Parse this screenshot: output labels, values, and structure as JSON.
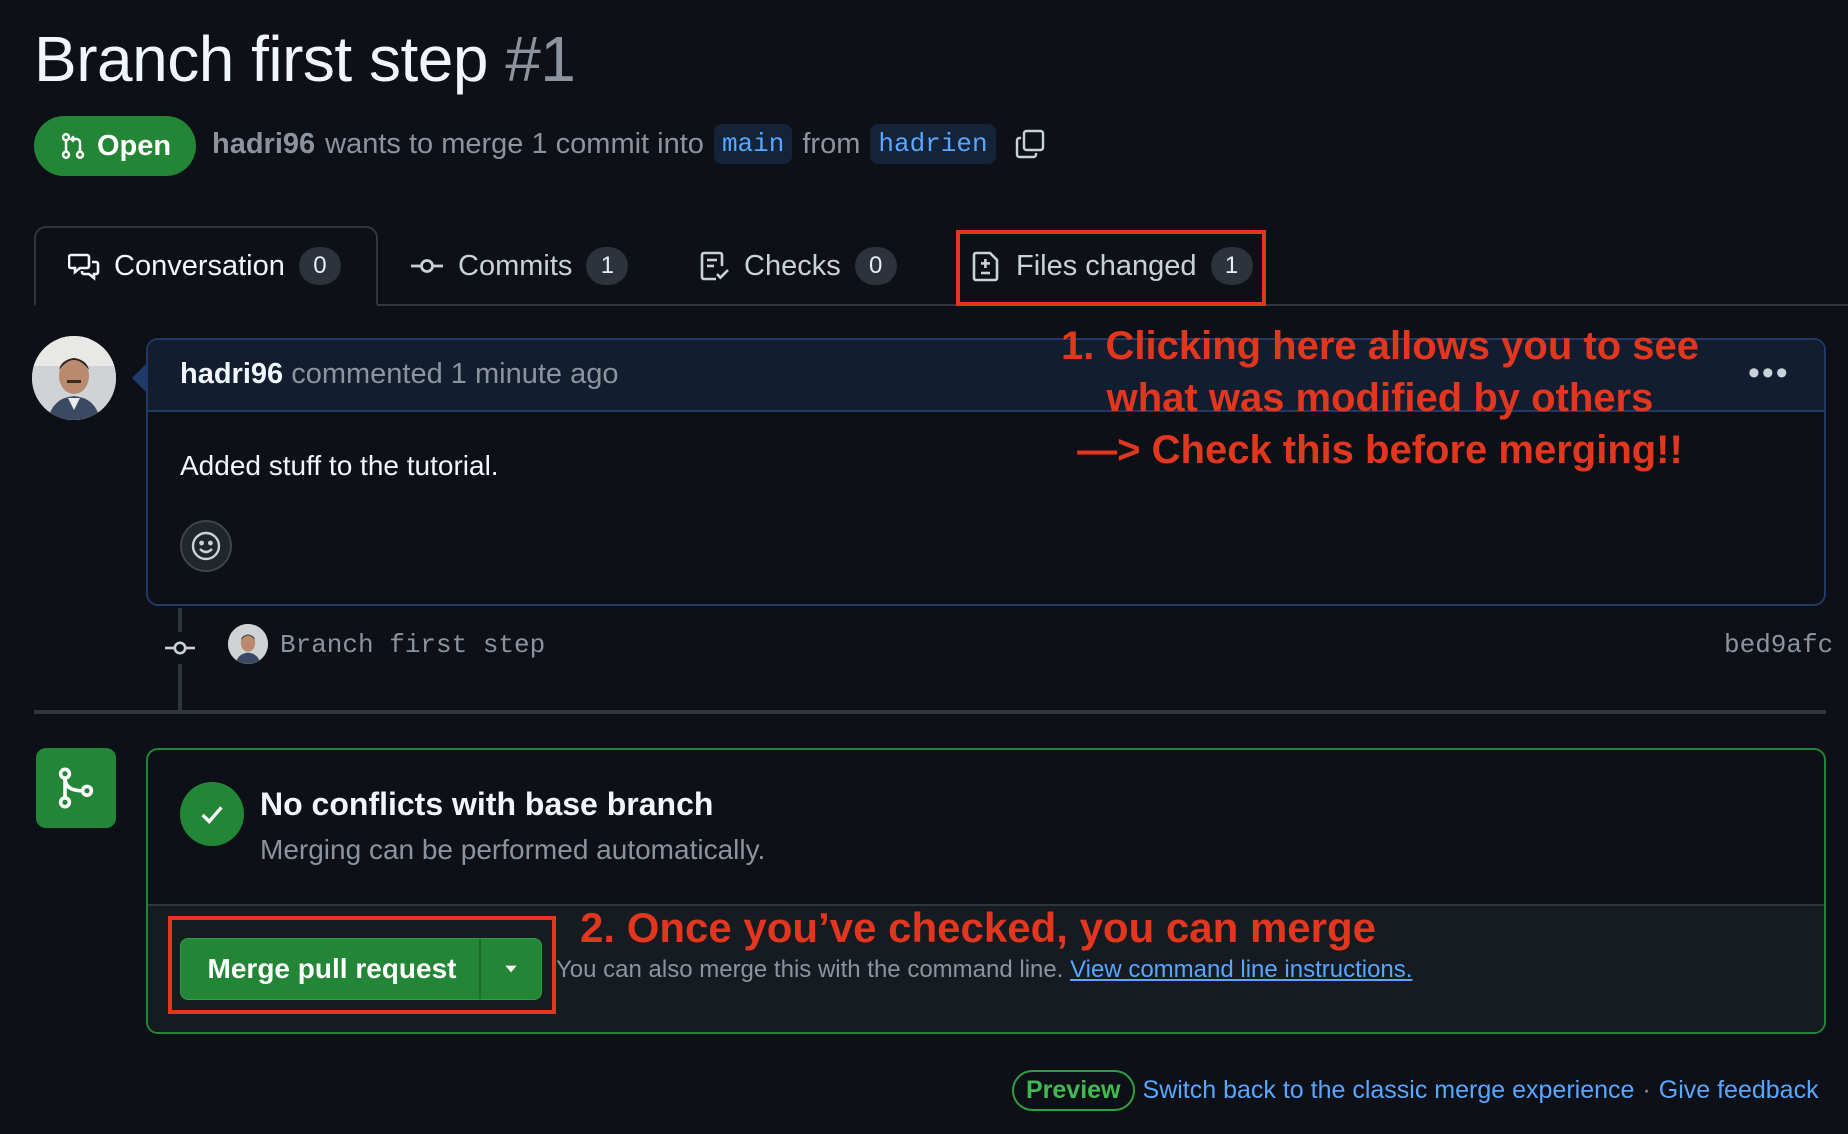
{
  "pr": {
    "title": "Branch first step",
    "number": "#1",
    "status": "Open",
    "author": "hadri96",
    "merge_text": "wants to merge 1 commit into",
    "base_branch": "main",
    "from_text": "from",
    "head_branch": "hadrien"
  },
  "tabs": [
    {
      "label": "Conversation",
      "count": "0",
      "icon": "comment-discussion-icon"
    },
    {
      "label": "Commits",
      "count": "1",
      "icon": "commit-icon"
    },
    {
      "label": "Checks",
      "count": "0",
      "icon": "checklist-icon"
    },
    {
      "label": "Files changed",
      "count": "1",
      "icon": "file-diff-icon"
    }
  ],
  "comment": {
    "author": "hadri96",
    "meta": "commented 1 minute ago",
    "body": "Added stuff to the tutorial."
  },
  "commit": {
    "message": "Branch first step",
    "sha": "bed9afc"
  },
  "merge": {
    "title": "No conflicts with base branch",
    "subtitle": "Merging can be performed automatically.",
    "button_label": "Merge pull request",
    "cli_text": "You can also merge this with the command line.",
    "cli_link": "View command line instructions."
  },
  "footer": {
    "preview_label": "Preview",
    "switch_link": "Switch back to the classic merge experience",
    "separator": "·",
    "feedback_link": "Give feedback"
  },
  "annotations": {
    "note1_line1": "1. Clicking here allows you to see",
    "note1_line2": "what was modified by others",
    "note1_line3": "—> Check this before merging!!",
    "note2": "2. Once you’ve checked, you can merge"
  },
  "colors": {
    "background": "#0d1117",
    "accent_green": "#238636",
    "link_blue": "#58a6ff",
    "annotation_red": "#e2361f"
  }
}
